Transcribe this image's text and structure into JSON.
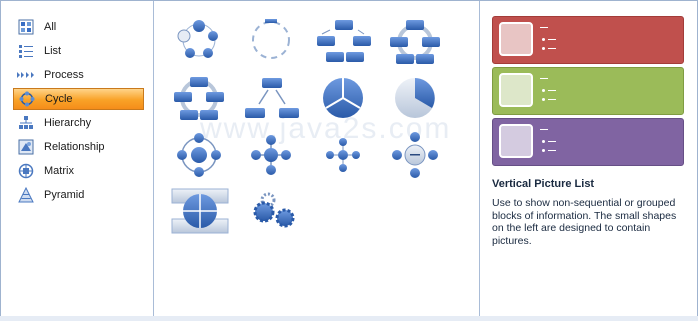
{
  "categories": [
    {
      "label": "All",
      "icon": "all-icon"
    },
    {
      "label": "List",
      "icon": "list-icon"
    },
    {
      "label": "Process",
      "icon": "process-icon"
    },
    {
      "label": "Cycle",
      "icon": "cycle-icon",
      "selected": true
    },
    {
      "label": "Hierarchy",
      "icon": "hierarchy-icon"
    },
    {
      "label": "Relationship",
      "icon": "relationship-icon"
    },
    {
      "label": "Matrix",
      "icon": "matrix-icon"
    },
    {
      "label": "Pyramid",
      "icon": "pyramid-icon"
    }
  ],
  "gallery": {
    "watermark": "www.java2s.com",
    "thumbnails": [
      "basic-cycle",
      "text-cycle",
      "block-cycle",
      "nondirectional-cycle",
      "continuous-cycle",
      "multidirectional-cycle",
      "segmented-cycle",
      "basic-pie",
      "radial-cycle",
      "basic-radial",
      "radial-cluster",
      "diverging-radial",
      "cycle-matrix",
      "gear"
    ]
  },
  "preview": {
    "title": "Vertical Picture List",
    "description": "Use to show non-sequential or grouped blocks of information. The small shapes on the left are designed to contain pictures.",
    "colors": {
      "red": "#c0504d",
      "green": "#9bbb59",
      "purple": "#8064a2"
    }
  }
}
